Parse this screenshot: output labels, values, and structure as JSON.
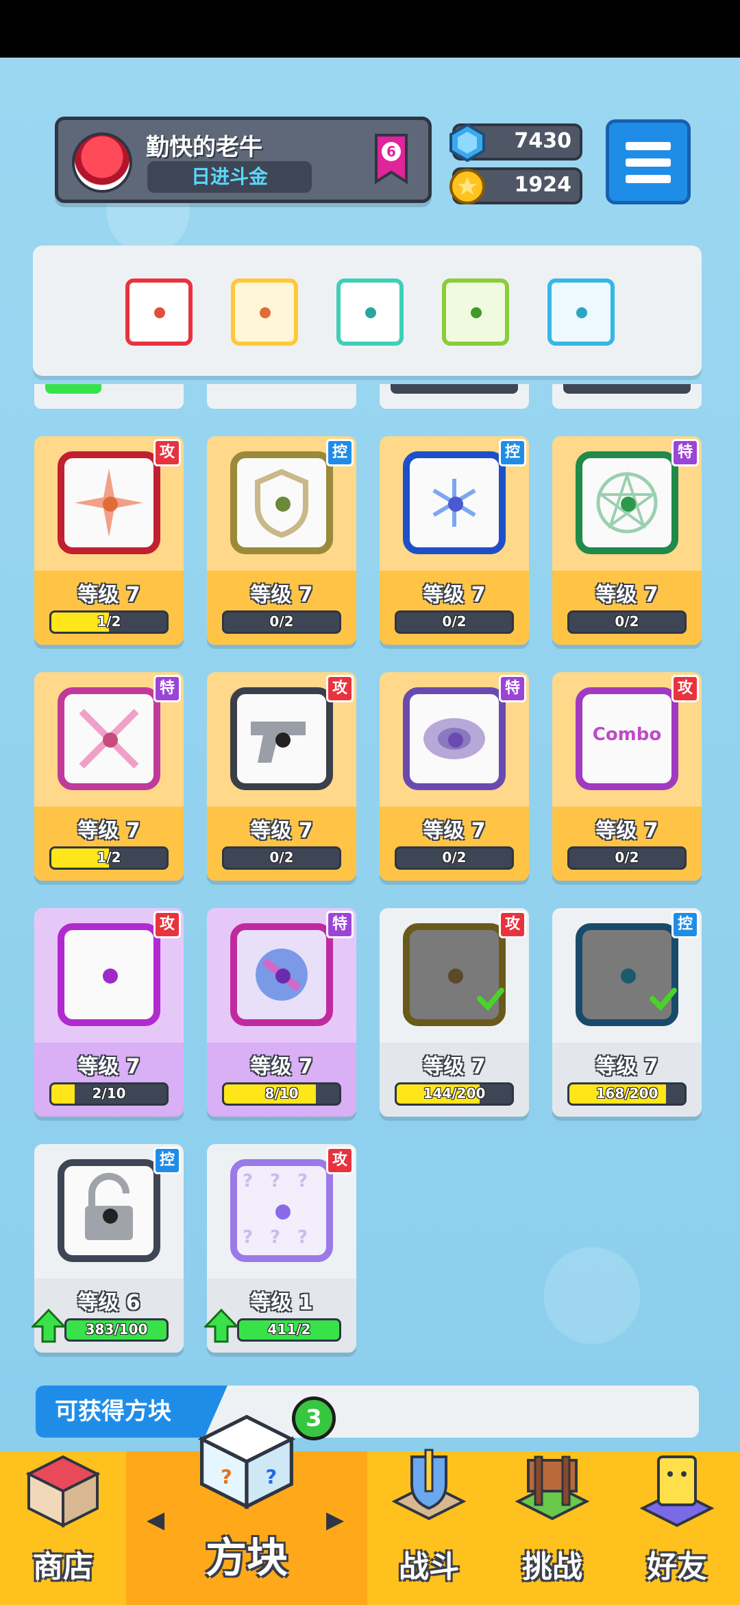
{
  "player": {
    "name": "勤快的老牛",
    "rank": "日进斗金",
    "rank_badge": "6"
  },
  "currency": {
    "gems": "7430",
    "coins": "1924"
  },
  "colors": {
    "red": "#e8333f",
    "yellow": "#ffc83a",
    "teal": "#3fcfb6",
    "green": "#8acc3a",
    "cyan": "#35b7e6"
  },
  "cards": [
    {
      "tag": "攻",
      "level": "等级 7",
      "progress": "1/2",
      "fill": 0.5
    },
    {
      "tag": "控",
      "level": "等级 7",
      "progress": "0/2",
      "fill": 0
    },
    {
      "tag": "控",
      "level": "等级 7",
      "progress": "0/2",
      "fill": 0
    },
    {
      "tag": "特",
      "level": "等级 7",
      "progress": "0/2",
      "fill": 0
    },
    {
      "tag": "特",
      "level": "等级 7",
      "progress": "1/2",
      "fill": 0.5
    },
    {
      "tag": "攻",
      "level": "等级 7",
      "progress": "0/2",
      "fill": 0
    },
    {
      "tag": "特",
      "level": "等级 7",
      "progress": "0/2",
      "fill": 0
    },
    {
      "tag": "攻",
      "level": "等级 7",
      "progress": "0/2",
      "fill": 0,
      "art_text": "Combo"
    },
    {
      "tag": "攻",
      "level": "等级 7",
      "progress": "2/10",
      "fill": 0.2
    },
    {
      "tag": "特",
      "level": "等级 7",
      "progress": "8/10",
      "fill": 0.8
    },
    {
      "tag": "攻",
      "level": "等级 7",
      "progress": "144/200",
      "fill": 0.72
    },
    {
      "tag": "控",
      "level": "等级 7",
      "progress": "168/200",
      "fill": 0.84
    },
    {
      "tag": "控",
      "level": "等级 6",
      "progress": "383/100",
      "fill": 1
    },
    {
      "tag": "攻",
      "level": "等级 1",
      "progress": "411/2",
      "fill": 1
    }
  ],
  "obtain": {
    "label": "可获得方块"
  },
  "nav": {
    "count": "3",
    "shop": "商店",
    "dice": "方块",
    "battle": "战斗",
    "challenge": "挑战",
    "friends": "好友",
    "prev": "◀",
    "next": "▶"
  }
}
